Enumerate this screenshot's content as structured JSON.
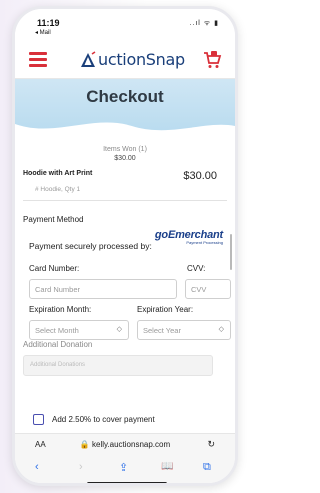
{
  "status": {
    "time": "11:19",
    "back_app": "◂ Mail",
    "icons": "..ıl ᯤ ▮"
  },
  "header": {
    "logo_text": "uctionSnap",
    "menu_icon": "hamburger-menu-icon",
    "cart_icon": "cart-icon",
    "brand_color": "#d9303a",
    "logo_color": "#1a3f7a"
  },
  "banner": {
    "title": "Checkout",
    "color": "#c4e1f2"
  },
  "summary": {
    "items_won": "Items Won (1)",
    "total": "$30.00",
    "item_name": "Hoodie with Art Print",
    "item_price": "$30.00",
    "item_detail": "# Hoodie, Qty 1"
  },
  "payment": {
    "section_label": "Payment Method",
    "secure_text": "Payment securely processed by:",
    "merchant_name": "goEmerchant",
    "merchant_tagline": "Payment Processing",
    "card_number_label": "Card Number:",
    "card_number_placeholder": "Card Number",
    "cvv_label": "CVV:",
    "cvv_placeholder": "CVV",
    "exp_month_label": "Expiration Month:",
    "exp_month_value": "Select Month",
    "exp_year_label": "Expiration Year:",
    "exp_year_value": "Select Year"
  },
  "donation": {
    "label": "Additional Donation",
    "placeholder": "Additional Donations",
    "cover_fee_text": "Add 2.50% to cover payment"
  },
  "browser": {
    "aa": "AA",
    "url": "🔒 kelly.auctionsnap.com",
    "reload": "↻",
    "back": "‹",
    "forward": "›",
    "share": "⇪",
    "bookmarks": "📖",
    "tabs": "⧉",
    "accent": "#2a6ee8"
  }
}
